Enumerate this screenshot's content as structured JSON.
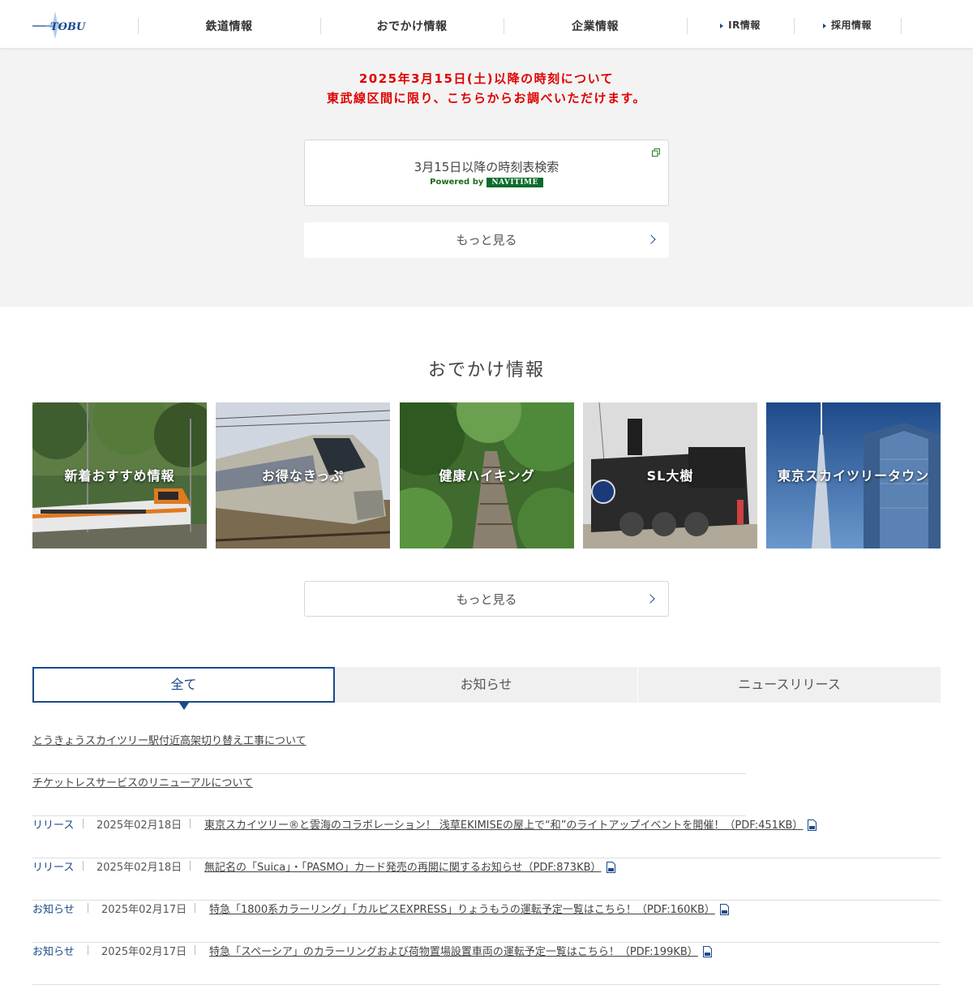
{
  "header": {
    "logo_text": "TOBU",
    "nav": [
      {
        "label": "鉄道情報"
      },
      {
        "label": "おでかけ情報"
      },
      {
        "label": "企業情報"
      },
      {
        "label": "IR情報"
      },
      {
        "label": "採用情報"
      }
    ]
  },
  "notice": {
    "line1": "2025年3月15日(土)以降の時刻について",
    "line2": "東武線区間に限り、こちらからお調べいただけます。",
    "search_title": "3月15日以降の時刻表検索",
    "powered_by": "Powered by",
    "navitime": "NAVITIME",
    "more_label": "もっと見る"
  },
  "odekake": {
    "title": "おでかけ情報",
    "cards": [
      {
        "label": "新着おすすめ情報"
      },
      {
        "label": "お得なきっぷ"
      },
      {
        "label": "健康ハイキング"
      },
      {
        "label": "SL大樹"
      },
      {
        "label": "東京スカイツリータウン"
      }
    ],
    "more_label": "もっと見る"
  },
  "tabs": [
    {
      "label": "全て"
    },
    {
      "label": "お知らせ"
    },
    {
      "label": "ニュースリリース"
    }
  ],
  "news": [
    {
      "category": "",
      "date": "",
      "title": "とうきょうスカイツリー駅付近高架切り替え工事について",
      "pdf": false
    },
    {
      "category": "",
      "date": "",
      "title": "チケットレスサービスのリニューアルについて",
      "pdf": false
    },
    {
      "category": "リリース",
      "date": "2025年02月18日",
      "title": "東京スカイツリー®と雲海のコラボレーション！ 浅草EKIMISEの屋上で“和”のライトアップイベントを開催！（PDF:451KB）",
      "pdf": true
    },
    {
      "category": "リリース",
      "date": "2025年02月18日",
      "title": "無記名の「Suica」・「PASMO」カード発売の再開に関するお知らせ（PDF:873KB）",
      "pdf": true
    },
    {
      "category": "お知らせ",
      "date": "2025年02月17日",
      "title": "特急「1800系カラーリング」「カルピスEXPRESS」りょうもうの運転予定一覧はこちら！（PDF:160KB）",
      "pdf": true
    },
    {
      "category": "お知らせ",
      "date": "2025年02月17日",
      "title": "特急「スペーシア」のカラーリングおよび荷物置場設置車両の運転予定一覧はこちら！（PDF:199KB）",
      "pdf": true
    }
  ]
}
